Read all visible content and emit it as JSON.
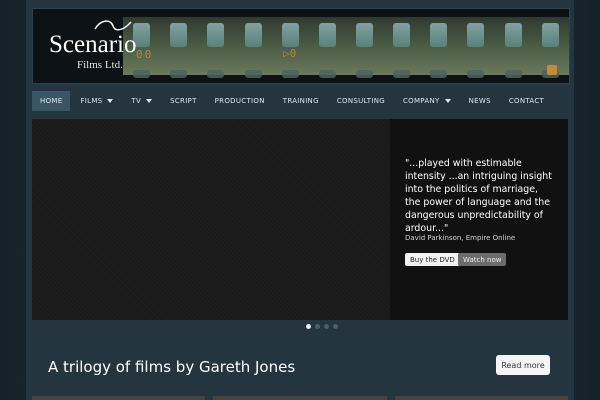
{
  "header": {
    "logo_name": "Scenario",
    "logo_sub": "Films Ltd.",
    "strip_counter": "00",
    "strip_mark": "▷0"
  },
  "nav": {
    "items": [
      {
        "label": "HOME",
        "active": true,
        "dropdown": false
      },
      {
        "label": "FILMS",
        "active": false,
        "dropdown": true
      },
      {
        "label": "TV",
        "active": false,
        "dropdown": true
      },
      {
        "label": "SCRIPT",
        "active": false,
        "dropdown": false
      },
      {
        "label": "PRODUCTION",
        "active": false,
        "dropdown": false
      },
      {
        "label": "TRAINING",
        "active": false,
        "dropdown": false
      },
      {
        "label": "CONSULTING",
        "active": false,
        "dropdown": false
      },
      {
        "label": "COMPANY",
        "active": false,
        "dropdown": true
      },
      {
        "label": "NEWS",
        "active": false,
        "dropdown": false
      },
      {
        "label": "CONTACT",
        "active": false,
        "dropdown": false
      }
    ]
  },
  "slider": {
    "quote": "\"...played with estimable intensity ...an intriguing insight into the politics of marriage, the power of language and the dangerous unpredictability of ardour...\"",
    "source": "David Parkinson, Empire Online",
    "buy_label": "Buy the DVD",
    "watch_label": "Watch now",
    "slide_count": 4,
    "active_slide": 1
  },
  "intro": {
    "title": "A trilogy of films by Gareth Jones",
    "read_more_label": "Read more"
  },
  "colors": {
    "background": "#1d2a33",
    "panel": "#243540",
    "nav_active": "#3a5566"
  },
  "icons": {
    "logo_swirl": "swirl-icon",
    "rss": "rss-icon",
    "dropdown": "caret-down-icon"
  }
}
